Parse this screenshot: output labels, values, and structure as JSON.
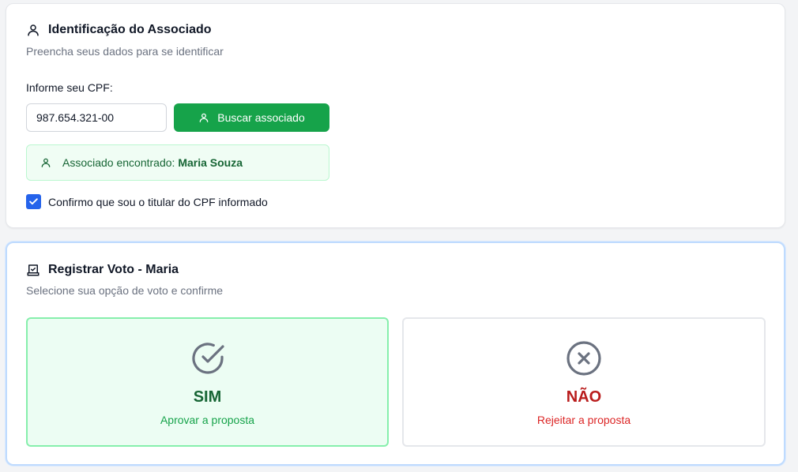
{
  "identification": {
    "title": "Identificação do Associado",
    "subtitle": "Preencha seus dados para se identificar",
    "cpf_label": "Informe seu CPF:",
    "cpf_value": "987.654.321-00",
    "search_button": "Buscar associado",
    "found_prefix": "Associado encontrado: ",
    "found_name": "Maria Souza",
    "confirm_label": "Confirmo que sou o titular do CPF informado",
    "confirm_checked": true,
    "icons": {
      "title": "user-icon",
      "button": "user-icon",
      "found": "user-icon",
      "checkbox": "check-icon"
    }
  },
  "vote": {
    "title": "Registrar Voto - Maria",
    "subtitle": "Selecione sua opção de voto e confirme",
    "options": [
      {
        "title": "SIM",
        "description": "Aprovar a proposta",
        "icon": "check-circle-icon",
        "selected": true
      },
      {
        "title": "NÃO",
        "description": "Rejeitar a proposta",
        "icon": "x-circle-icon",
        "selected": false
      }
    ],
    "icons": {
      "title": "ballot-box-icon"
    }
  },
  "colors": {
    "primary_green": "#16a34a",
    "success_bg": "#f0fdf4",
    "success_text": "#166534",
    "danger_text": "#b91c1c",
    "checkbox_blue": "#2563eb",
    "vote_card_border": "#bfdbfe"
  }
}
